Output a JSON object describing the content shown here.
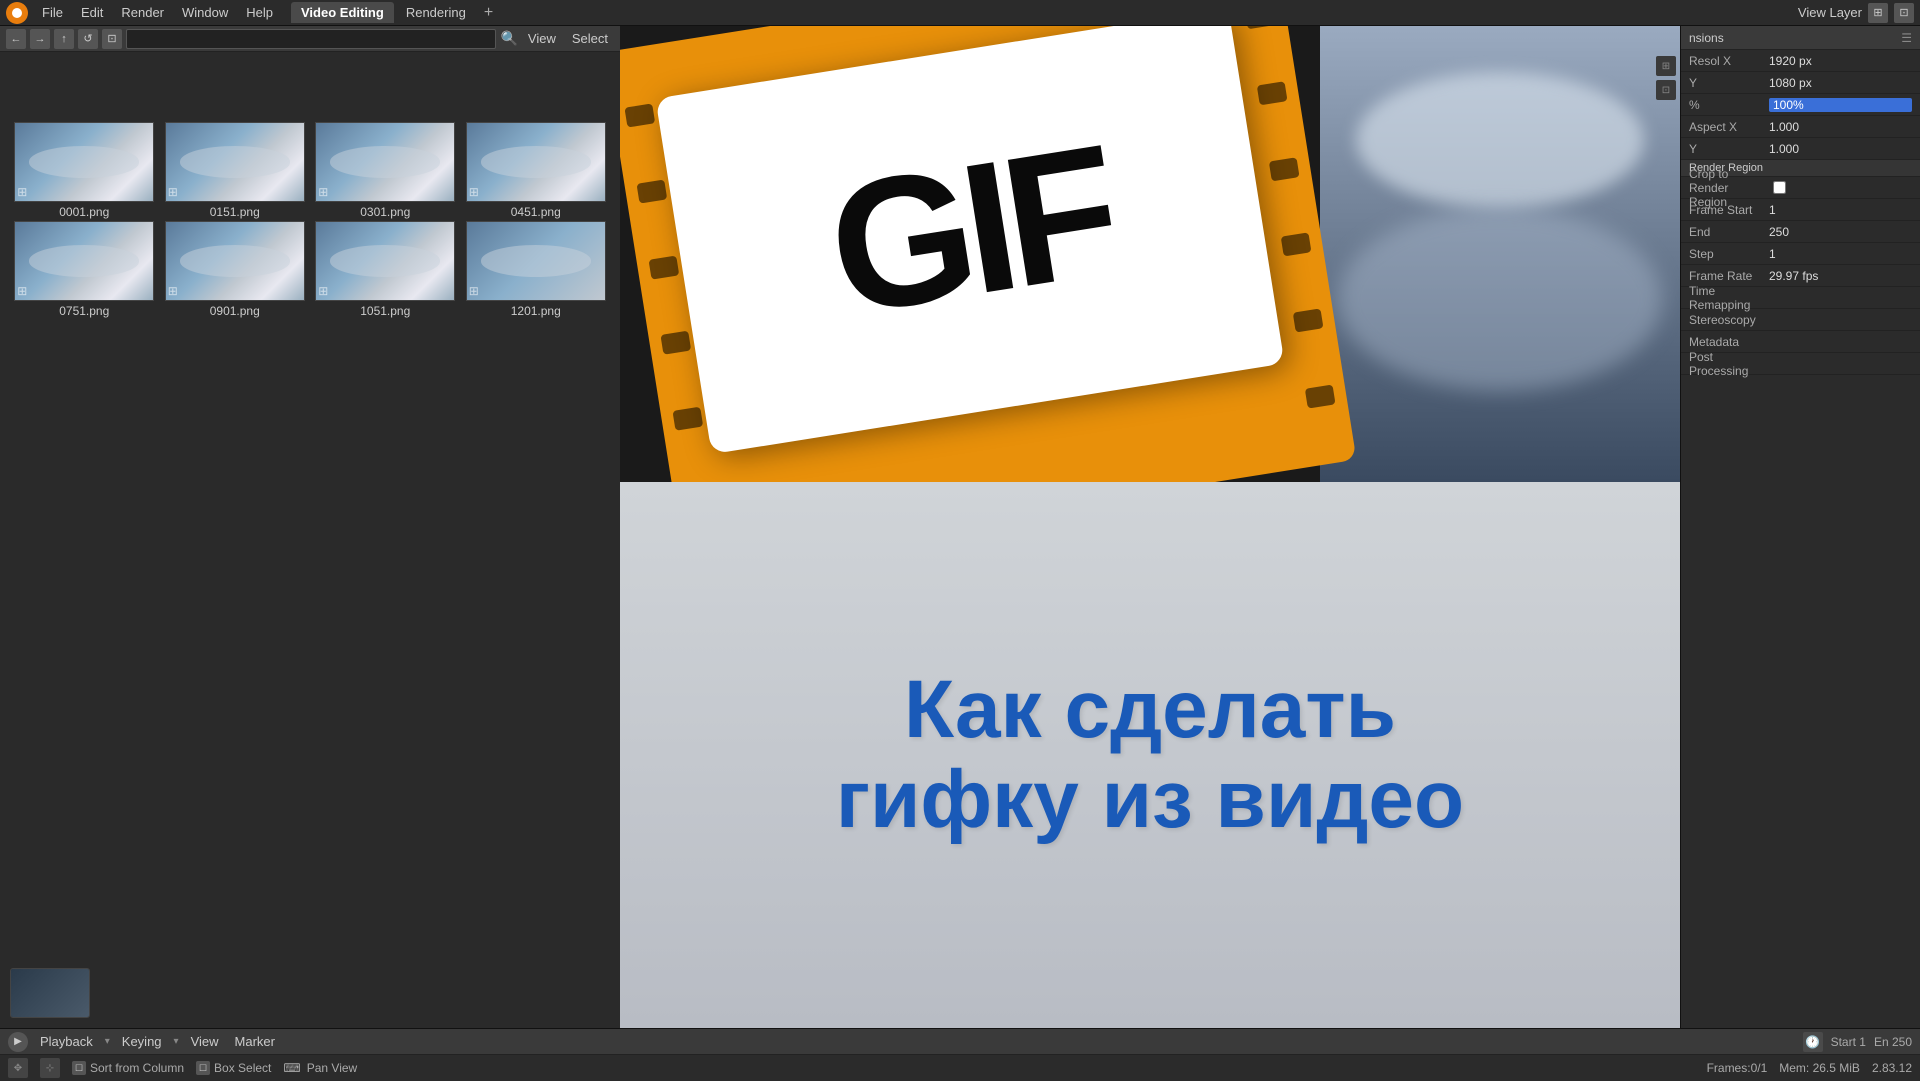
{
  "app": {
    "title": "Blender Video Editing"
  },
  "menubar": {
    "logo": "blender-logo",
    "items": [
      "File",
      "Edit",
      "Render",
      "Window",
      "Help"
    ],
    "workspace_tabs": [
      "Video Editing",
      "Rendering"
    ],
    "add_tab": "+"
  },
  "file_browser": {
    "nav_buttons": [
      "←",
      "→",
      "↑",
      "↺",
      "⊡"
    ],
    "view_menu": [
      "View",
      "Select"
    ],
    "thumbnails": [
      {
        "filename": "0001.png"
      },
      {
        "filename": "0151.png"
      },
      {
        "filename": "0301.png"
      },
      {
        "filename": "0451.png"
      },
      {
        "filename": "0751.png"
      },
      {
        "filename": "0901.png"
      },
      {
        "filename": "1051.png"
      },
      {
        "filename": "1201.png"
      }
    ]
  },
  "preview": {
    "gif_text": "GIF",
    "title_russian_line1": "Как сделать",
    "title_russian_line2": "гифку из видео"
  },
  "properties": {
    "header": "nsions",
    "rows": [
      {
        "label": "Resol X",
        "value": "1920 px"
      },
      {
        "label": "Y",
        "value": "1080 px"
      },
      {
        "label": "%",
        "value": "100%",
        "highlight": true
      },
      {
        "label": "Aspect X",
        "value": "1.000"
      },
      {
        "label": "Y",
        "value": "1.000"
      },
      {
        "label": "Render Region",
        "value": ""
      },
      {
        "label": "Crop to Render Region",
        "value": ""
      },
      {
        "label": "Frame Start",
        "value": "1"
      },
      {
        "label": "End",
        "value": "250"
      },
      {
        "label": "Step",
        "value": "1"
      },
      {
        "label": "Frame Rate",
        "value": "29.97 fps"
      },
      {
        "label": "Time Remapping",
        "value": ""
      },
      {
        "label": "Stereoscopy",
        "value": ""
      },
      {
        "label": "Metadata",
        "value": ""
      },
      {
        "label": "Post Processing",
        "value": ""
      }
    ]
  },
  "timeline": {
    "menu_items": [
      "Playback",
      "Keying",
      "View",
      "Marker"
    ],
    "bottom_items": [
      "Sort from Column",
      "Box Select",
      "Pan View"
    ],
    "status_items": [
      "Frames:0/1",
      "Mem: 26.5 MiB",
      "2.83.12"
    ],
    "start": "Start 1",
    "end": "En 250"
  },
  "view_layer": {
    "label": "View Layer"
  }
}
